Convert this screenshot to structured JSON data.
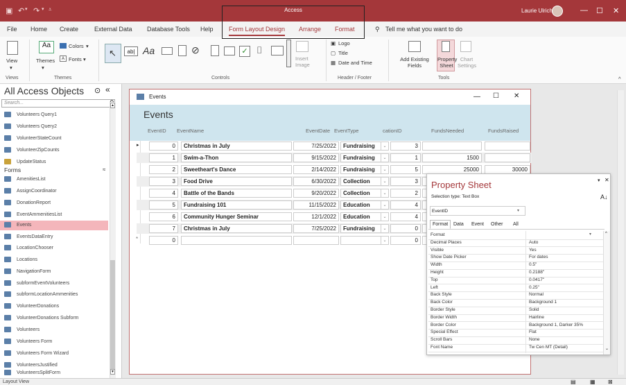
{
  "window": {
    "context_label": "Access",
    "user": "Laurie Ulrich"
  },
  "tabs": [
    "File",
    "Home",
    "Create",
    "External Data",
    "Database Tools",
    "Help",
    "Form Layout Design",
    "Arrange",
    "Format"
  ],
  "tell_me": "Tell me what you want to do",
  "ribbon": {
    "views": {
      "label": "View",
      "group": "Views"
    },
    "themes": {
      "themes": "Themes",
      "colors": "Colors",
      "fonts": "Fonts",
      "group": "Themes"
    },
    "controls_group": "Controls",
    "insert_image": "Insert Image",
    "header_footer": {
      "logo": "Logo",
      "title": "Title",
      "date_time": "Date and Time",
      "group": "Header / Footer"
    },
    "tools": {
      "add_fields": "Add Existing Fields",
      "property_sheet": "Property Sheet",
      "chart_settings": "Chart Settings",
      "group": "Tools"
    }
  },
  "nav": {
    "title": "All Access Objects",
    "search_placeholder": "Search...",
    "queries": [
      "Volunteers Query1",
      "Volunteers Query2",
      "VolunteerStateCount",
      "VolunteerZipCounts",
      "UpdateStatus"
    ],
    "forms_section": "Forms",
    "forms": [
      "AmenitiesList",
      "AssignCoordinator",
      "DonationReport",
      "EventAmmenitiesList",
      "Events",
      "EventsDataEntry",
      "LocationChooser",
      "Locations",
      "NavigationForm",
      "subformEventVolunteers",
      "subformLocationAmmenities",
      "VolunteerDonations",
      "VolunteerDonations Subform",
      "Volunteers",
      "Volunteers Form",
      "Volunteers Form Wizard",
      "VolunteersJustified",
      "VolunteersSplitForm"
    ],
    "selected": "Events"
  },
  "form": {
    "window_title": "Events",
    "header_title": "Events",
    "columns": [
      "EventID",
      "EventName",
      "EventDate",
      "EventType",
      "cationID",
      "FundsNeeded",
      "FundsRaised"
    ],
    "rows": [
      {
        "id": "0",
        "name": "Christmas in July",
        "date": "7/25/2022",
        "type": "Fundraising",
        "loc": "3",
        "needed": "",
        "raised": ""
      },
      {
        "id": "1",
        "name": "Swim-a-Thon",
        "date": "9/15/2022",
        "type": "Fundraising",
        "loc": "1",
        "needed": "1500",
        "raised": ""
      },
      {
        "id": "2",
        "name": "Sweetheart's Dance",
        "date": "2/14/2022",
        "type": "Fundraising",
        "loc": "5",
        "needed": "25000",
        "raised": "30000"
      },
      {
        "id": "3",
        "name": "Food Drive",
        "date": "6/30/2022",
        "type": "Collection",
        "loc": "3",
        "needed": "",
        "raised": ""
      },
      {
        "id": "4",
        "name": "Battle of the Bands",
        "date": "9/20/2022",
        "type": "Collection",
        "loc": "2",
        "needed": "",
        "raised": ""
      },
      {
        "id": "5",
        "name": "Fundraising 101",
        "date": "11/15/2022",
        "type": "Education",
        "loc": "4",
        "needed": "",
        "raised": ""
      },
      {
        "id": "6",
        "name": "Community Hunger Seminar",
        "date": "12/1/2022",
        "type": "Education",
        "loc": "4",
        "needed": "",
        "raised": ""
      },
      {
        "id": "7",
        "name": "Christmas in July",
        "date": "7/25/2022",
        "type": "Fundraising",
        "loc": "0",
        "needed": "",
        "raised": ""
      }
    ],
    "new_row": {
      "id": "0",
      "loc": "0"
    }
  },
  "property_sheet": {
    "title": "Property Sheet",
    "selection_type": "Selection type:  Text Box",
    "selected_control": "EventID",
    "tabs": [
      "Format",
      "Data",
      "Event",
      "Other",
      "All"
    ],
    "properties": [
      [
        "Format",
        ""
      ],
      [
        "Decimal Places",
        "Auto"
      ],
      [
        "Visible",
        "Yes"
      ],
      [
        "Show Date Picker",
        "For dates"
      ],
      [
        "Width",
        "0.5\""
      ],
      [
        "Height",
        "0.2188\""
      ],
      [
        "Top",
        "0.0417\""
      ],
      [
        "Left",
        "0.25\""
      ],
      [
        "Back Style",
        "Normal"
      ],
      [
        "Back Color",
        "Background 1"
      ],
      [
        "Border Style",
        "Solid"
      ],
      [
        "Border Width",
        "Hairline"
      ],
      [
        "Border Color",
        "Background 1, Darker 35%"
      ],
      [
        "Special Effect",
        "Flat"
      ],
      [
        "Scroll Bars",
        "None"
      ],
      [
        "Font Name",
        "Tw Cen MT (Detail)"
      ]
    ]
  },
  "status": {
    "text": "Layout View"
  },
  "colors": {
    "accent": "#a4373a",
    "header_band": "#cfe5ee",
    "selected_nav": "#f4b6bb"
  }
}
